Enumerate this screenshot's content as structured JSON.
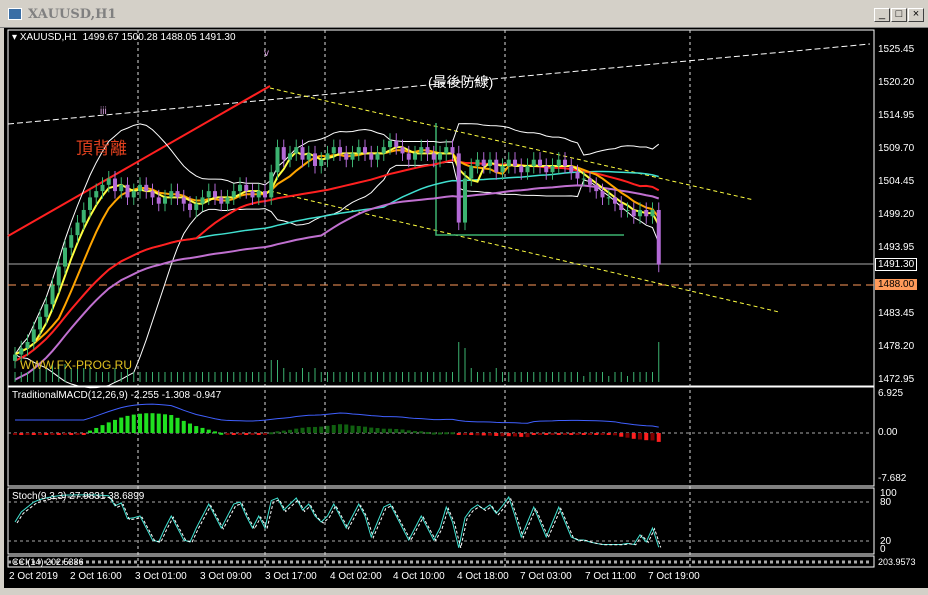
{
  "window": {
    "title": "XAUUSD,H1",
    "minimize": "_",
    "maximize": "□",
    "close": "×"
  },
  "chart_header": {
    "symbol": "XAUUSD,H1",
    "ohlc": "1499.67 1500.28 1488.05 1491.30"
  },
  "annotations": {
    "divergence": "頂背離",
    "last_line": "(最後防線)",
    "mark_iii": "iii",
    "mark_v": "v",
    "watermark": "WWW.FX-PROG.RU"
  },
  "price_axis": [
    "1525.45",
    "1520.20",
    "1514.95",
    "1509.70",
    "1504.45",
    "1499.20",
    "1493.95",
    "1483.45",
    "1478.20",
    "1472.95"
  ],
  "current_price": "1491.30",
  "level_price": "1488.00",
  "macd": {
    "label": "TraditionalMACD(12,26,9) -2.255 -1.308 -0.947",
    "axis": [
      "6.925",
      "0.00",
      "-7.682"
    ]
  },
  "stoch": {
    "label": "Stoch(9,3,3) 27.9831 38.6899",
    "axis": [
      "100",
      "80",
      "20",
      "0"
    ]
  },
  "cci": {
    "label": "CCI(14) 202.5336",
    "axis": "203.9573"
  },
  "time_axis": [
    "2 Oct 2019",
    "2 Oct 16:00",
    "3 Oct 01:00",
    "3 Oct 09:00",
    "3 Oct 17:00",
    "4 Oct 02:00",
    "4 Oct 10:00",
    "4 Oct 18:00",
    "7 Oct 03:00",
    "7 Oct 11:00",
    "7 Oct 19:00"
  ],
  "colors": {
    "up": "#3cb371",
    "down": "#b36ad6",
    "ma_fast": "#ffff40",
    "ma_mid": "#ffa500",
    "ma_slow": "#ff2020",
    "ma_long": "#40e0d0",
    "level": "#ff9a5a"
  },
  "chart_data": {
    "type": "candlestick",
    "ylim": [
      1472.95,
      1525.45
    ],
    "closes": [
      1477,
      1478,
      1479,
      1481,
      1483,
      1485,
      1488,
      1491,
      1494,
      1496,
      1498,
      1500,
      1502,
      1503,
      1504,
      1505,
      1503,
      1504,
      1502,
      1503,
      1504,
      1503,
      1502,
      1501,
      1502,
      1503,
      1502,
      1501,
      1500,
      1501,
      1502,
      1503,
      1502,
      1501,
      1502,
      1503,
      1504,
      1503,
      1502,
      1503,
      1502,
      1506,
      1510,
      1508,
      1509,
      1510,
      1508,
      1509,
      1507,
      1508,
      1509,
      1510,
      1509,
      1508,
      1509,
      1510,
      1509,
      1508,
      1509,
      1510,
      1511,
      1510,
      1509,
      1508,
      1509,
      1510,
      1509,
      1508,
      1509,
      1510,
      1509,
      1498,
      1505,
      1507,
      1508,
      1507,
      1508,
      1506,
      1507,
      1508,
      1507,
      1506,
      1507,
      1508,
      1507,
      1506,
      1507,
      1508,
      1507,
      1506,
      1505,
      1505,
      1504,
      1503,
      1502,
      1502,
      1501,
      1500,
      1500,
      1499,
      1500,
      1499,
      1500,
      1491.3
    ]
  }
}
